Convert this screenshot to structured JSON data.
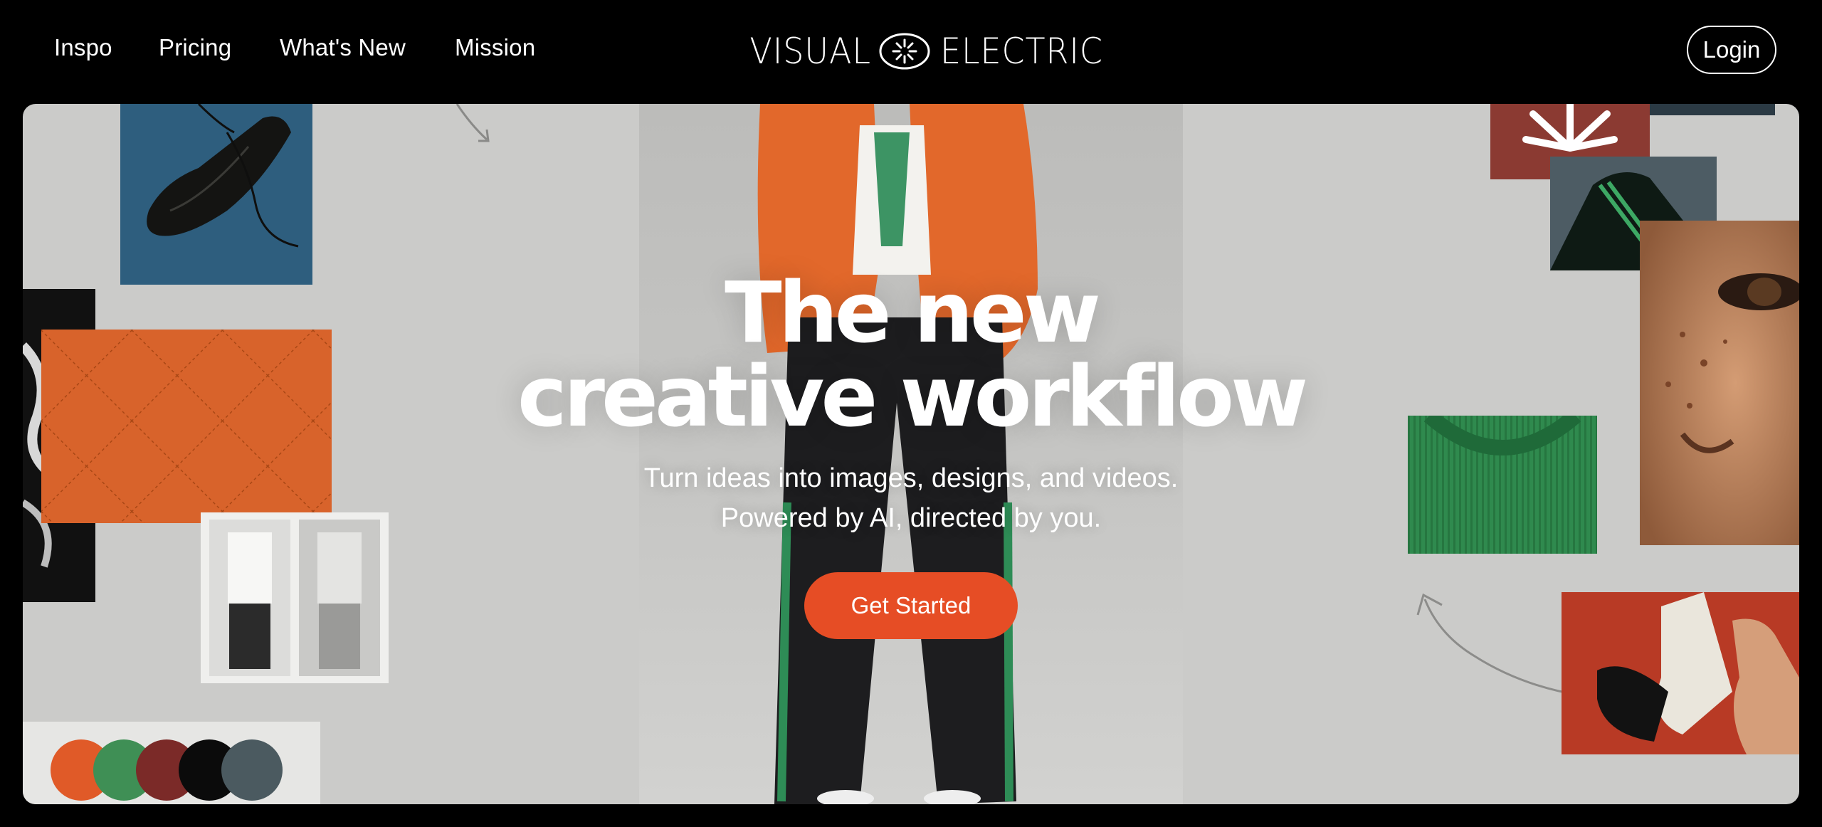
{
  "nav": {
    "links": [
      {
        "label": "Inspo"
      },
      {
        "label": "Pricing"
      },
      {
        "label": "What's New"
      },
      {
        "label": "Mission"
      }
    ],
    "logo": {
      "left": "VISUAL",
      "right": "ELECTRIC",
      "icon": "sun-burst-icon"
    },
    "login_label": "Login"
  },
  "hero": {
    "title_line1": "The new",
    "title_line2": "creative workflow",
    "subtitle_line1": "Turn ideas into images, designs, and videos.",
    "subtitle_line2": "Powered by AI, directed by you.",
    "cta_label": "Get Started"
  },
  "colors": {
    "background": "#000000",
    "canvas": "#cbcbc9",
    "cta": "#e64d25",
    "swatches": [
      "#e05a28",
      "#3f8f55",
      "#7b2a28",
      "#0b0b0b",
      "#4b5a60"
    ]
  }
}
